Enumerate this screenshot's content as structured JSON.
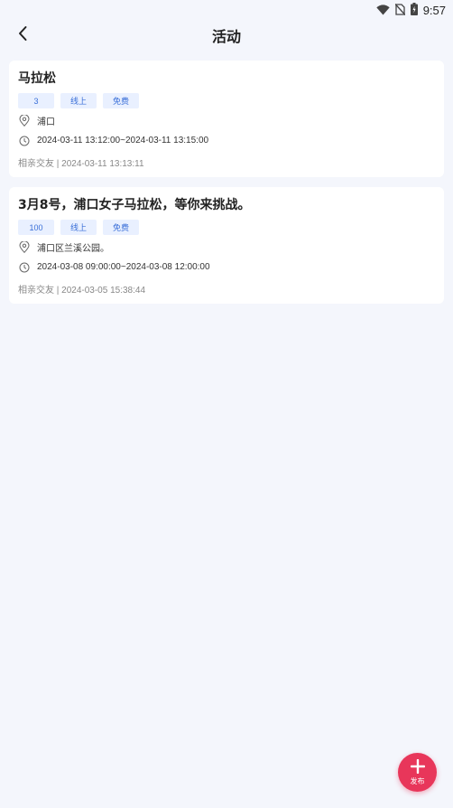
{
  "status_bar": {
    "time": "9:57",
    "icons": [
      "wifi-icon",
      "no-sim-icon",
      "battery-charging-icon"
    ]
  },
  "nav": {
    "title": "活动",
    "back_icon": "chevron-left-icon"
  },
  "activities": [
    {
      "title": "马拉松",
      "tags": [
        "3",
        "线上",
        "免费"
      ],
      "location": "浦口",
      "time_range": "2024-03-11 13:12:00~2024-03-11 13:15:00",
      "meta": "相亲交友 | 2024-03-11 13:13:11"
    },
    {
      "title": "3月8号，浦口女子马拉松，等你来挑战。",
      "tags": [
        "100",
        "线上",
        "免费"
      ],
      "location": "浦口区兰溪公园。",
      "time_range": "2024-03-08 09:00:00~2024-03-08 12:00:00",
      "meta": "相亲交友 | 2024-03-05 15:38:44"
    }
  ],
  "fab": {
    "label": "发布",
    "icon": "plus-icon",
    "color": "#e8365a"
  },
  "colors": {
    "background": "#f4f6fc",
    "tag_bg": "#e9f0ff",
    "tag_text": "#3a6fd8"
  }
}
